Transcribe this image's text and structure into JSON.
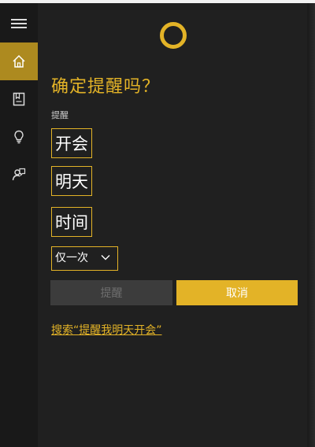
{
  "sidebar": {
    "items": [
      {
        "icon": "hamburger-menu-icon"
      },
      {
        "icon": "home-icon",
        "active": true
      },
      {
        "icon": "notebook-icon"
      },
      {
        "icon": "lightbulb-icon"
      },
      {
        "icon": "feedback-icon"
      }
    ]
  },
  "header": {
    "icon": "cortana-ring-icon"
  },
  "reminder": {
    "title": "确定提醒吗？",
    "field_label": "提醒",
    "tokens": [
      "开会",
      "明天",
      "时间"
    ],
    "repeat_value": "仅一次",
    "remind_label": "提醒",
    "cancel_label": "取消",
    "search_link": "搜索“提醒我明天开会”"
  },
  "colors": {
    "accent": "#e3b327",
    "active_nav": "#ad8a1f",
    "background": "#202020",
    "sidebar": "#191919",
    "disabled_button": "#3c3c3c"
  }
}
